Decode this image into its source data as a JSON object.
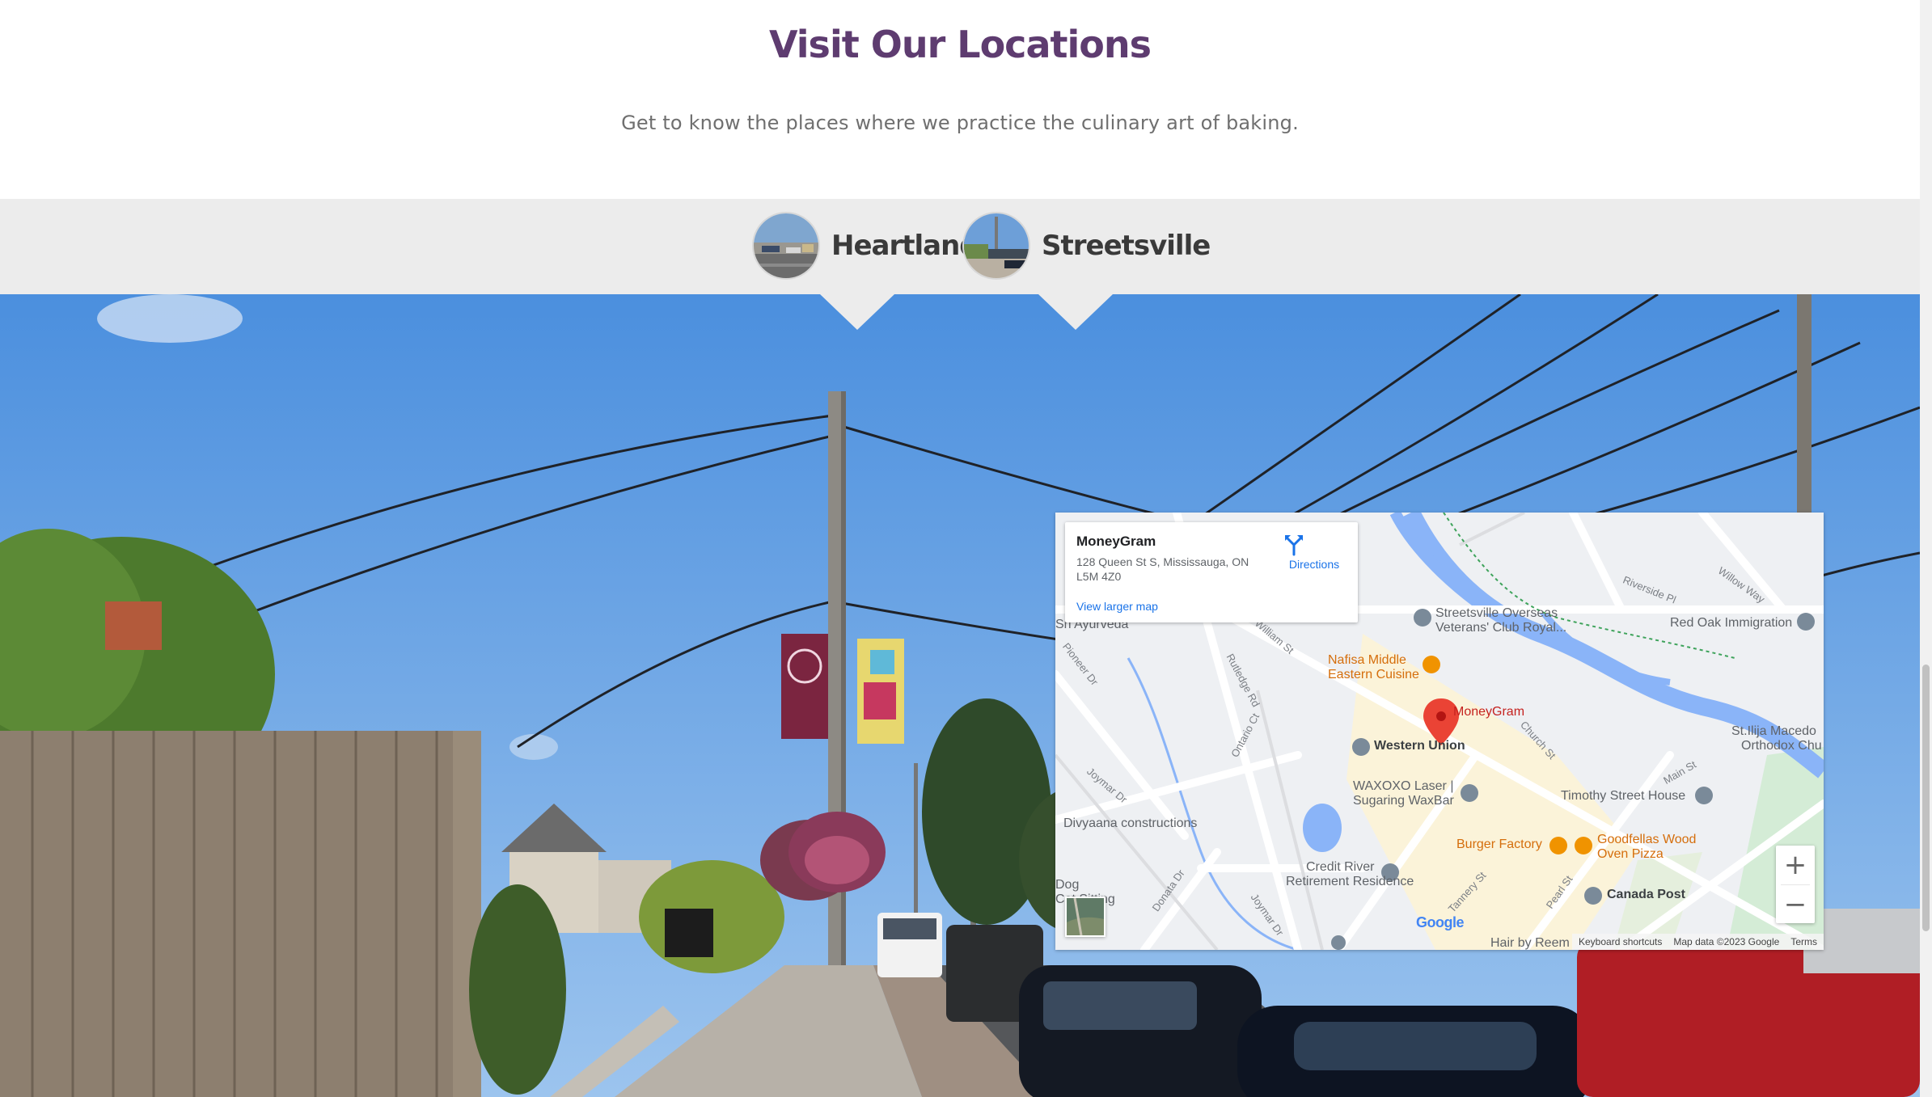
{
  "header": {
    "title": "Visit Our Locations",
    "subtitle": "Get to know the places where we practice the culinary art of baking."
  },
  "tabs": [
    {
      "label": "Heartland",
      "icon": "heartland-thumbnail"
    },
    {
      "label": "Streetsville",
      "icon": "streetsville-thumbnail"
    }
  ],
  "map": {
    "place_name": "MoneyGram",
    "address": "128 Queen St S, Mississauga, ON L5M 4Z0",
    "directions_label": "Directions",
    "view_larger_label": "View larger map",
    "zoom_in": "+",
    "zoom_out": "−",
    "logo": "Google",
    "attribution": {
      "shortcuts": "Keyboard shortcuts",
      "data": "Map data ©2023 Google",
      "terms": "Terms"
    },
    "pins": {
      "moneygram": "MoneyGram",
      "western_union": "Western Union",
      "streetsville_club": "Streetsville Overseas",
      "streetsville_club_2": "Veterans' Club Royal...",
      "nafisa": "Nafisa Middle",
      "nafisa_2": "Eastern Cuisine",
      "waxoxo": "WAXOXO Laser |",
      "waxoxo_2": "Sugaring WaxBar",
      "timothy": "Timothy Street House",
      "burger": "Burger Factory",
      "goodfellas": "Goodfellas Wood",
      "goodfellas_2": "Oven Pizza",
      "credit_river": "Credit River",
      "credit_river_2": "Retirement Residence",
      "canada_post": "Canada Post",
      "divyaana": "Divyaana constructions",
      "red_oak": "Red Oak Immigration",
      "st_ilija": "St.Ilija Macedo",
      "st_ilija_2": "Orthodox Chu",
      "sri": "Sri Ayurveda",
      "dog": "Dog",
      "dog_2": "Cat Sitting",
      "hair": "Hair by Reem"
    },
    "roads": {
      "william": "William St",
      "rutledge": "Rutledge Rd",
      "ontario": "Ontario Ct",
      "pioneer": "Pioneer Dr",
      "joymar": "Joymar Dr",
      "joymar2": "Joymar Dr",
      "donata": "Donata Dr",
      "church": "Church St",
      "main": "Main St",
      "tannery": "Tannery St",
      "pearl": "Pearl St",
      "riverside": "Riverside Pl",
      "willow": "Willow Way"
    }
  }
}
